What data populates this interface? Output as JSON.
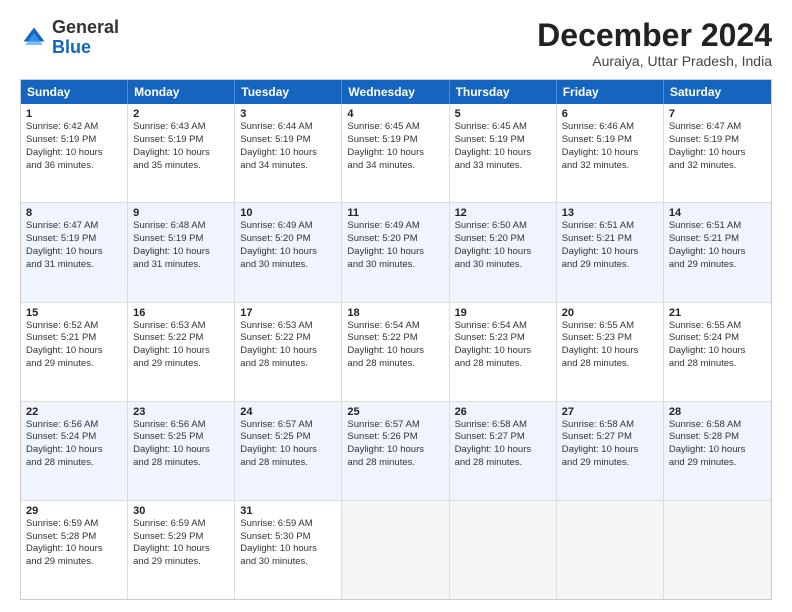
{
  "logo": {
    "general": "General",
    "blue": "Blue"
  },
  "title": "December 2024",
  "subtitle": "Auraiya, Uttar Pradesh, India",
  "headers": [
    "Sunday",
    "Monday",
    "Tuesday",
    "Wednesday",
    "Thursday",
    "Friday",
    "Saturday"
  ],
  "rows": [
    {
      "alt": false,
      "cells": [
        {
          "day": "1",
          "lines": [
            "Sunrise: 6:42 AM",
            "Sunset: 5:19 PM",
            "Daylight: 10 hours",
            "and 36 minutes."
          ]
        },
        {
          "day": "2",
          "lines": [
            "Sunrise: 6:43 AM",
            "Sunset: 5:19 PM",
            "Daylight: 10 hours",
            "and 35 minutes."
          ]
        },
        {
          "day": "3",
          "lines": [
            "Sunrise: 6:44 AM",
            "Sunset: 5:19 PM",
            "Daylight: 10 hours",
            "and 34 minutes."
          ]
        },
        {
          "day": "4",
          "lines": [
            "Sunrise: 6:45 AM",
            "Sunset: 5:19 PM",
            "Daylight: 10 hours",
            "and 34 minutes."
          ]
        },
        {
          "day": "5",
          "lines": [
            "Sunrise: 6:45 AM",
            "Sunset: 5:19 PM",
            "Daylight: 10 hours",
            "and 33 minutes."
          ]
        },
        {
          "day": "6",
          "lines": [
            "Sunrise: 6:46 AM",
            "Sunset: 5:19 PM",
            "Daylight: 10 hours",
            "and 32 minutes."
          ]
        },
        {
          "day": "7",
          "lines": [
            "Sunrise: 6:47 AM",
            "Sunset: 5:19 PM",
            "Daylight: 10 hours",
            "and 32 minutes."
          ]
        }
      ]
    },
    {
      "alt": true,
      "cells": [
        {
          "day": "8",
          "lines": [
            "Sunrise: 6:47 AM",
            "Sunset: 5:19 PM",
            "Daylight: 10 hours",
            "and 31 minutes."
          ]
        },
        {
          "day": "9",
          "lines": [
            "Sunrise: 6:48 AM",
            "Sunset: 5:19 PM",
            "Daylight: 10 hours",
            "and 31 minutes."
          ]
        },
        {
          "day": "10",
          "lines": [
            "Sunrise: 6:49 AM",
            "Sunset: 5:20 PM",
            "Daylight: 10 hours",
            "and 30 minutes."
          ]
        },
        {
          "day": "11",
          "lines": [
            "Sunrise: 6:49 AM",
            "Sunset: 5:20 PM",
            "Daylight: 10 hours",
            "and 30 minutes."
          ]
        },
        {
          "day": "12",
          "lines": [
            "Sunrise: 6:50 AM",
            "Sunset: 5:20 PM",
            "Daylight: 10 hours",
            "and 30 minutes."
          ]
        },
        {
          "day": "13",
          "lines": [
            "Sunrise: 6:51 AM",
            "Sunset: 5:21 PM",
            "Daylight: 10 hours",
            "and 29 minutes."
          ]
        },
        {
          "day": "14",
          "lines": [
            "Sunrise: 6:51 AM",
            "Sunset: 5:21 PM",
            "Daylight: 10 hours",
            "and 29 minutes."
          ]
        }
      ]
    },
    {
      "alt": false,
      "cells": [
        {
          "day": "15",
          "lines": [
            "Sunrise: 6:52 AM",
            "Sunset: 5:21 PM",
            "Daylight: 10 hours",
            "and 29 minutes."
          ]
        },
        {
          "day": "16",
          "lines": [
            "Sunrise: 6:53 AM",
            "Sunset: 5:22 PM",
            "Daylight: 10 hours",
            "and 29 minutes."
          ]
        },
        {
          "day": "17",
          "lines": [
            "Sunrise: 6:53 AM",
            "Sunset: 5:22 PM",
            "Daylight: 10 hours",
            "and 28 minutes."
          ]
        },
        {
          "day": "18",
          "lines": [
            "Sunrise: 6:54 AM",
            "Sunset: 5:22 PM",
            "Daylight: 10 hours",
            "and 28 minutes."
          ]
        },
        {
          "day": "19",
          "lines": [
            "Sunrise: 6:54 AM",
            "Sunset: 5:23 PM",
            "Daylight: 10 hours",
            "and 28 minutes."
          ]
        },
        {
          "day": "20",
          "lines": [
            "Sunrise: 6:55 AM",
            "Sunset: 5:23 PM",
            "Daylight: 10 hours",
            "and 28 minutes."
          ]
        },
        {
          "day": "21",
          "lines": [
            "Sunrise: 6:55 AM",
            "Sunset: 5:24 PM",
            "Daylight: 10 hours",
            "and 28 minutes."
          ]
        }
      ]
    },
    {
      "alt": true,
      "cells": [
        {
          "day": "22",
          "lines": [
            "Sunrise: 6:56 AM",
            "Sunset: 5:24 PM",
            "Daylight: 10 hours",
            "and 28 minutes."
          ]
        },
        {
          "day": "23",
          "lines": [
            "Sunrise: 6:56 AM",
            "Sunset: 5:25 PM",
            "Daylight: 10 hours",
            "and 28 minutes."
          ]
        },
        {
          "day": "24",
          "lines": [
            "Sunrise: 6:57 AM",
            "Sunset: 5:25 PM",
            "Daylight: 10 hours",
            "and 28 minutes."
          ]
        },
        {
          "day": "25",
          "lines": [
            "Sunrise: 6:57 AM",
            "Sunset: 5:26 PM",
            "Daylight: 10 hours",
            "and 28 minutes."
          ]
        },
        {
          "day": "26",
          "lines": [
            "Sunrise: 6:58 AM",
            "Sunset: 5:27 PM",
            "Daylight: 10 hours",
            "and 28 minutes."
          ]
        },
        {
          "day": "27",
          "lines": [
            "Sunrise: 6:58 AM",
            "Sunset: 5:27 PM",
            "Daylight: 10 hours",
            "and 29 minutes."
          ]
        },
        {
          "day": "28",
          "lines": [
            "Sunrise: 6:58 AM",
            "Sunset: 5:28 PM",
            "Daylight: 10 hours",
            "and 29 minutes."
          ]
        }
      ]
    },
    {
      "alt": false,
      "cells": [
        {
          "day": "29",
          "lines": [
            "Sunrise: 6:59 AM",
            "Sunset: 5:28 PM",
            "Daylight: 10 hours",
            "and 29 minutes."
          ]
        },
        {
          "day": "30",
          "lines": [
            "Sunrise: 6:59 AM",
            "Sunset: 5:29 PM",
            "Daylight: 10 hours",
            "and 29 minutes."
          ]
        },
        {
          "day": "31",
          "lines": [
            "Sunrise: 6:59 AM",
            "Sunset: 5:30 PM",
            "Daylight: 10 hours",
            "and 30 minutes."
          ]
        },
        {
          "day": "",
          "lines": []
        },
        {
          "day": "",
          "lines": []
        },
        {
          "day": "",
          "lines": []
        },
        {
          "day": "",
          "lines": []
        }
      ]
    }
  ]
}
